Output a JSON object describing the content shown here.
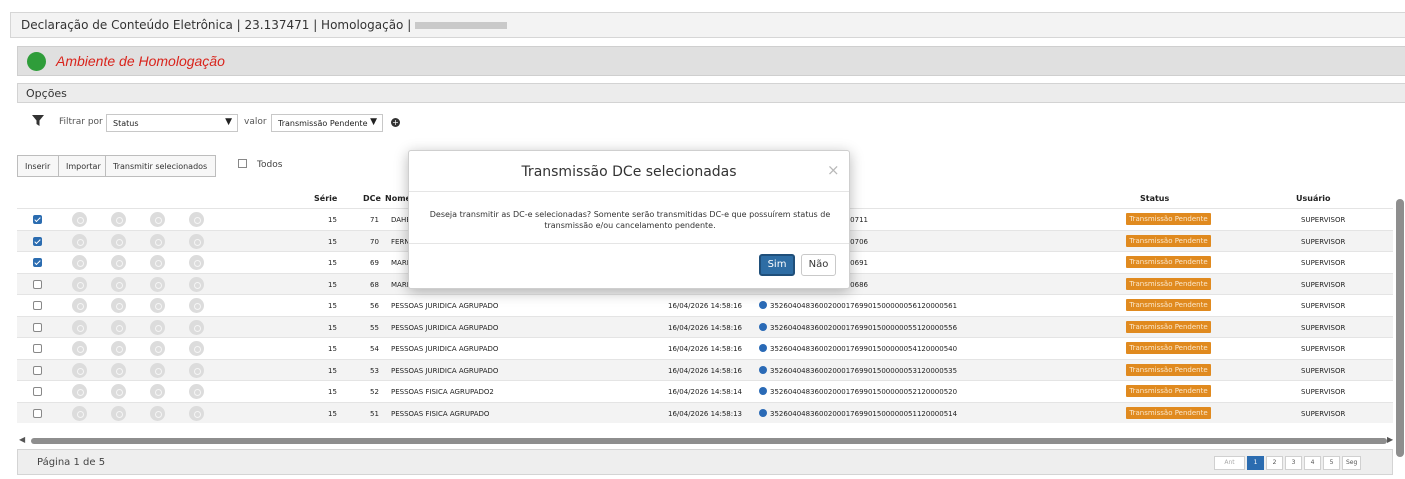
{
  "window": {
    "title": "Declaração de Conteúdo Eletrônica | 23.137471 | Homologação |"
  },
  "environment": {
    "label": "Ambiente de Homologação",
    "dot_color": "#2f9d3a",
    "label_color": "#d9241c"
  },
  "options": {
    "title": "Opções"
  },
  "filter": {
    "label": "Filtrar por",
    "field": "Status",
    "value_label": "valor",
    "value": "Transmissão Pendente",
    "icons": [
      "funnel-icon",
      "chevron-down-icon",
      "plus-circle-icon"
    ]
  },
  "toolbar": {
    "inserir": "Inserir",
    "importar": "Importar",
    "transmitir": "Transmitir selecionados",
    "todos": "Todos"
  },
  "table": {
    "headers": {
      "serie": "Série",
      "dce": "DCe",
      "nome": "Nome",
      "status": "Status",
      "usuario": "Usuário"
    },
    "rows": [
      {
        "checked": true,
        "serie": "15",
        "dce": "71",
        "nome": "DAHE",
        "data": "",
        "chave": "9901500000071120000711",
        "status": "Transmissão Pendente",
        "usuario": "SUPERVISOR"
      },
      {
        "checked": true,
        "serie": "15",
        "dce": "70",
        "nome": "FERN",
        "data": "",
        "chave": "9901500000070120000706",
        "status": "Transmissão Pendente",
        "usuario": "SUPERVISOR"
      },
      {
        "checked": true,
        "serie": "15",
        "dce": "69",
        "nome": "MARIA",
        "data": "",
        "chave": "9901500000069120000691",
        "status": "Transmissão Pendente",
        "usuario": "SUPERVISOR"
      },
      {
        "checked": false,
        "serie": "15",
        "dce": "68",
        "nome": "MARIA",
        "data": "",
        "chave": "9901500000068120000686",
        "status": "Transmissão Pendente",
        "usuario": "SUPERVISOR"
      },
      {
        "checked": false,
        "serie": "15",
        "dce": "56",
        "nome": "PESSOAS JURIDICA AGRUPADO",
        "data": "16/04/2026 14:58:16",
        "chave": "35260404836002000176990150000005612000056​1",
        "status": "Transmissão Pendente",
        "usuario": "SUPERVISOR"
      },
      {
        "checked": false,
        "serie": "15",
        "dce": "55",
        "nome": "PESSOAS JURIDICA AGRUPADO",
        "data": "16/04/2026 14:58:16",
        "chave": "352604048360020001769901500000055120000556",
        "status": "Transmissão Pendente",
        "usuario": "SUPERVISOR"
      },
      {
        "checked": false,
        "serie": "15",
        "dce": "54",
        "nome": "PESSOAS JURIDICA AGRUPADO",
        "data": "16/04/2026 14:58:16",
        "chave": "352604048360020001769901500000054120000540",
        "status": "Transmissão Pendente",
        "usuario": "SUPERVISOR"
      },
      {
        "checked": false,
        "serie": "15",
        "dce": "53",
        "nome": "PESSOAS JURIDICA AGRUPADO",
        "data": "16/04/2026 14:58:16",
        "chave": "352604048360020001769901500000053120000535",
        "status": "Transmissão Pendente",
        "usuario": "SUPERVISOR"
      },
      {
        "checked": false,
        "serie": "15",
        "dce": "52",
        "nome": "PESSOAS FISICA AGRUPADO2",
        "data": "16/04/2026 14:58:14",
        "chave": "352604048360020001769901500000052120000520",
        "status": "Transmissão Pendente",
        "usuario": "SUPERVISOR"
      },
      {
        "checked": false,
        "serie": "15",
        "dce": "51",
        "nome": "PESSOAS FISICA AGRUPADO",
        "data": "16/04/2026 14:58:13",
        "chave": "352604048360020001769901500000051120000514",
        "status": "Transmissão Pendente",
        "usuario": "SUPERVISOR"
      }
    ],
    "row_action_icons": [
      "view-icon",
      "edit-icon",
      "cancel-icon",
      "send-icon"
    ]
  },
  "footer": {
    "page_info": "Página 1 de 5",
    "prev": "Ant",
    "pages": [
      "1",
      "2",
      "3",
      "4",
      "5"
    ],
    "active_page": "1",
    "next": "Seg"
  },
  "modal": {
    "title": "Transmissão DCe selecionadas",
    "close": "×",
    "body": "Deseja transmitir as DC-e selecionadas? Somente serão transmitidas DC-e que possuírem status de transmissão e/ou cancelamento pendente.",
    "yes": "Sim",
    "no": "Não"
  },
  "colors": {
    "accent": "#2b6cb0",
    "status_badge": "#e08a1f"
  }
}
